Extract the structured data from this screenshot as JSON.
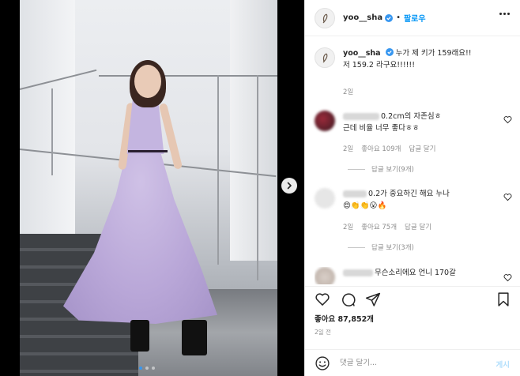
{
  "header": {
    "username": "yoo__sha",
    "separator": "•",
    "follow_label": "팔로우"
  },
  "caption": {
    "username": "yoo__sha",
    "text_line1": " 누가 제 키가 159래요!!",
    "text_line2": "저 159.2 라구요!!!!!!",
    "time": "2일"
  },
  "comments": [
    {
      "text_line1": "0.2cm의 자존심ㅎ",
      "text_line2": "근데 비율 너무 좋다ㅎㅎ",
      "time": "2일",
      "likes": "좋아요 109개",
      "reply": "답글 달기",
      "view_replies": "답글 보기(9개)"
    },
    {
      "text_line1": "0.2가 중요하긴 해요 누나",
      "emoji": "😍👏👏😮🔥",
      "time": "2일",
      "likes": "좋아요 75개",
      "reply": "답글 달기",
      "view_replies": "답글 보기(3개)"
    },
    {
      "text_line1": "무슨소리에요 언니 170갈"
    }
  ],
  "footer": {
    "likes": "좋아요 87,852개",
    "time": "2일 전",
    "comment_placeholder": "댓글 달기...",
    "post_label": "게시"
  },
  "colors": {
    "accent": "#0095f6",
    "muted": "#8e8e8e",
    "text": "#262626"
  },
  "icons": [
    "feather-avatar-icon",
    "verified-badge-icon",
    "more-options-icon",
    "heart-icon",
    "comment-icon",
    "share-icon",
    "bookmark-icon",
    "emoji-icon",
    "next-arrow-icon"
  ],
  "carousel": {
    "count": 3,
    "active_index": 0
  }
}
